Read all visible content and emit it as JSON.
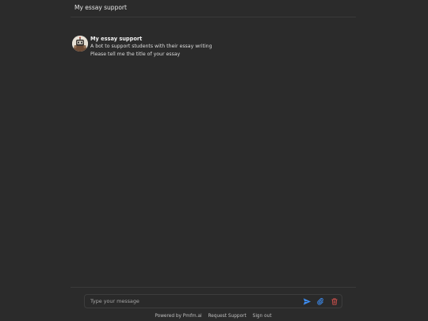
{
  "header": {
    "title": "My essay support"
  },
  "message": {
    "avatar_icon": "robot-avatar-icon",
    "bot_name": "My essay support",
    "description": "A bot to support students with their essay writing",
    "prompt": "Please tell me the title of your essay"
  },
  "composer": {
    "placeholder": "Type your message",
    "send_icon": "send-icon",
    "attach_icon": "paperclip-icon",
    "delete_icon": "trash-icon"
  },
  "footer": {
    "powered_by": "Powered by Pmfm.ai",
    "request_support": "Request Support",
    "sign_out": "Sign out"
  },
  "colors": {
    "background": "#2b2b2b",
    "send": "#3d8cf0",
    "attach": "#3d8cf0",
    "delete": "#d9534f"
  }
}
